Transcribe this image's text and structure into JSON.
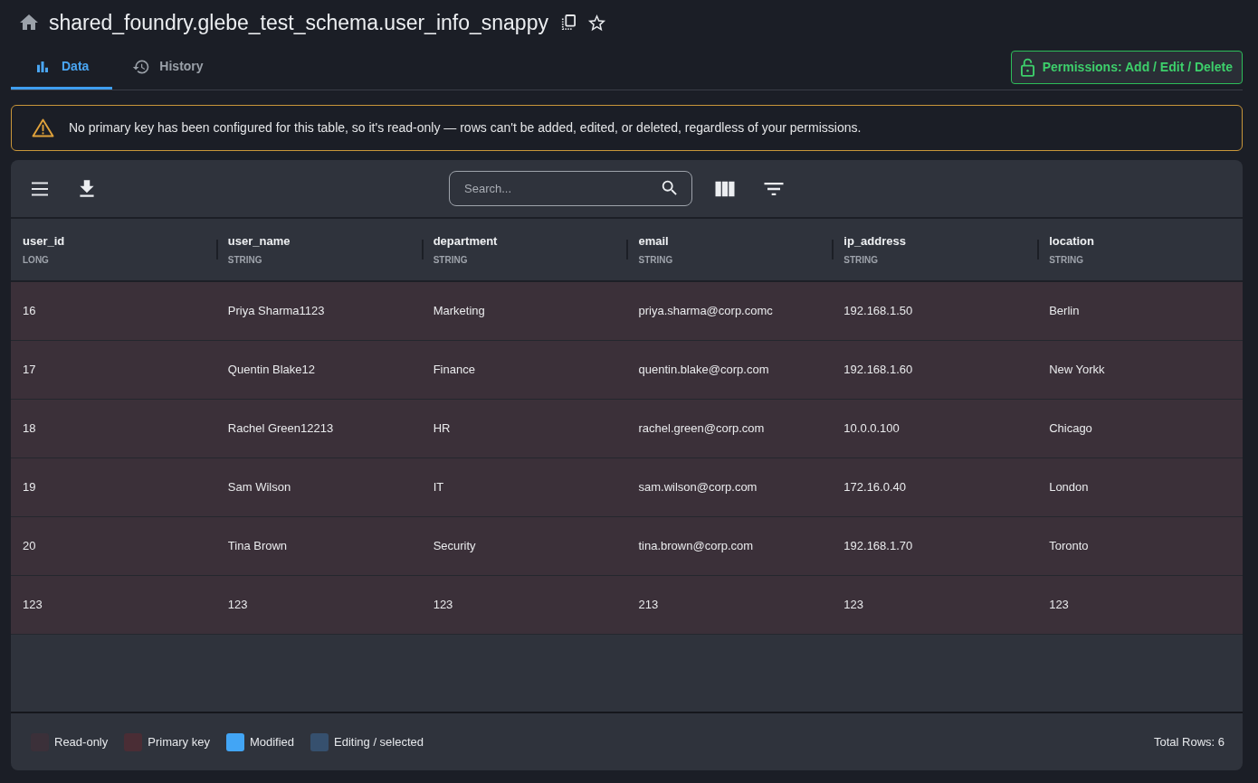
{
  "header": {
    "title": "shared_foundry.glebe_test_schema.user_info_snappy"
  },
  "tabs": [
    {
      "label": "Data",
      "selected": true
    },
    {
      "label": "History",
      "selected": false
    }
  ],
  "permissions_button": {
    "label": "Permissions: Add / Edit / Delete"
  },
  "warning": {
    "message": "No primary key has been configured for this table, so it's read-only — rows can't be added, edited, or deleted, regardless of your permissions."
  },
  "toolbar": {
    "search": {
      "placeholder": "Search..."
    }
  },
  "table": {
    "read_only": true,
    "columns": [
      {
        "name": "user_id",
        "type": "LONG"
      },
      {
        "name": "user_name",
        "type": "STRING"
      },
      {
        "name": "department",
        "type": "STRING"
      },
      {
        "name": "email",
        "type": "STRING"
      },
      {
        "name": "ip_address",
        "type": "STRING"
      },
      {
        "name": "location",
        "type": "STRING"
      }
    ],
    "rows": [
      [
        "16",
        "Priya Sharma1123",
        "Marketing",
        "priya.sharma@corp.comc",
        "192.168.1.50",
        "Berlin"
      ],
      [
        "17",
        "Quentin Blake12",
        "Finance",
        "quentin.blake@corp.com",
        "192.168.1.60",
        "New Yorkk"
      ],
      [
        "18",
        "Rachel Green12213",
        "HR",
        "rachel.green@corp.com",
        "10.0.0.100",
        "Chicago"
      ],
      [
        "19",
        "Sam Wilson",
        "IT",
        "sam.wilson@corp.com",
        "172.16.0.40",
        "London"
      ],
      [
        "20",
        "Tina Brown",
        "Security",
        "tina.brown@corp.com",
        "192.168.1.70",
        "Toronto"
      ],
      [
        "123",
        "123",
        "123",
        "213",
        "123",
        "123"
      ]
    ]
  },
  "legend": [
    {
      "label": "Read-only",
      "color": "#3b3039"
    },
    {
      "label": "Primary key",
      "color": "#4a2d35"
    },
    {
      "label": "Modified",
      "color": "#42a5f5"
    },
    {
      "label": "Editing / selected",
      "color": "#36506e"
    }
  ],
  "status_bar": {
    "total": "Total Rows: 6"
  }
}
